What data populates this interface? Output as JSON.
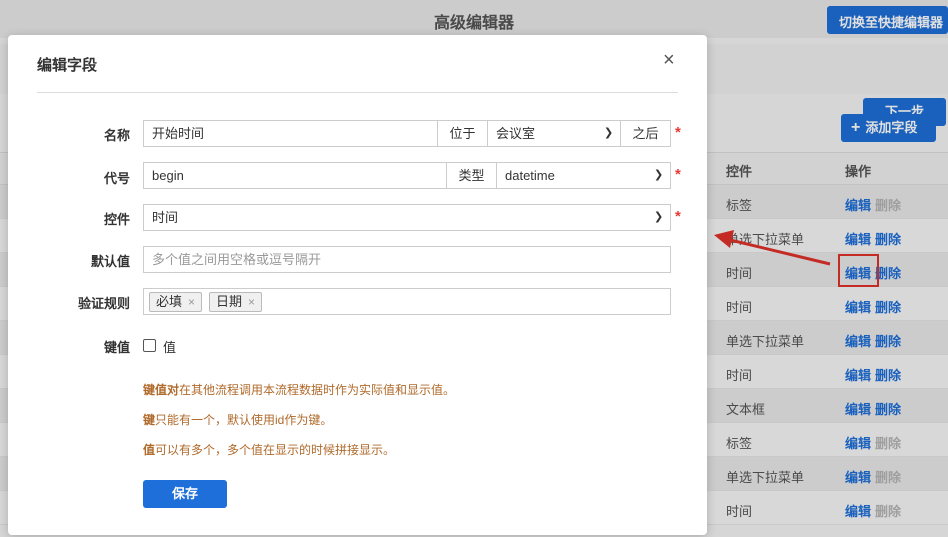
{
  "app": {
    "title": "高级编辑器",
    "switch_button": "切换至快捷编辑器",
    "next_button": "下一步",
    "add_field_button": "添加字段",
    "table": {
      "headers": [
        "控件",
        "操作"
      ],
      "rows": [
        {
          "type": "标签",
          "edit": "编辑",
          "delete": "删除",
          "delete_enabled": false
        },
        {
          "type": "单选下拉菜单",
          "edit": "编辑",
          "delete": "删除",
          "delete_enabled": true
        },
        {
          "type": "时间",
          "edit": "编辑",
          "delete": "删除",
          "delete_enabled": true
        },
        {
          "type": "时间",
          "edit": "编辑",
          "delete": "删除",
          "delete_enabled": true
        },
        {
          "type": "单选下拉菜单",
          "edit": "编辑",
          "delete": "删除",
          "delete_enabled": true
        },
        {
          "type": "时间",
          "edit": "编辑",
          "delete": "删除",
          "delete_enabled": true
        },
        {
          "type": "文本框",
          "edit": "编辑",
          "delete": "删除",
          "delete_enabled": true
        },
        {
          "type": "标签",
          "edit": "编辑",
          "delete": "删除",
          "delete_enabled": false
        },
        {
          "type": "单选下拉菜单",
          "edit": "编辑",
          "delete": "删除",
          "delete_enabled": false
        },
        {
          "type": "时间",
          "edit": "编辑",
          "delete": "删除",
          "delete_enabled": false
        }
      ]
    }
  },
  "modal": {
    "title": "编辑字段",
    "close": "×",
    "name_row": {
      "label": "名称",
      "value": "开始时间",
      "position_label": "位于",
      "position_value": "会议室",
      "after_label": "之后"
    },
    "code_row": {
      "label": "代号",
      "value": "begin",
      "type_label": "类型",
      "type_value": "datetime"
    },
    "control_row": {
      "label": "控件",
      "value": "时间"
    },
    "default_row": {
      "label": "默认值",
      "placeholder": "多个值之间用空格或逗号隔开"
    },
    "validation_row": {
      "label": "验证规则",
      "tags": [
        "必填",
        "日期"
      ]
    },
    "key_row": {
      "label": "键值",
      "checkbox_label": "值",
      "checked": false
    },
    "notes": [
      {
        "bold": "键值对",
        "text": "在其他流程调用本流程数据时作为实际值和显示值。"
      },
      {
        "bold": "键",
        "text": "只能有一个，默认使用id作为键。"
      },
      {
        "bold": "值",
        "text": "可以有多个，多个值在显示的时候拼接显示。"
      }
    ],
    "required_mark": "*",
    "save_button": "保存"
  },
  "colors": {
    "primary": "#1e6fd9",
    "required": "#e53935",
    "note": "#b06a2b",
    "highlight": "#e0322b"
  }
}
